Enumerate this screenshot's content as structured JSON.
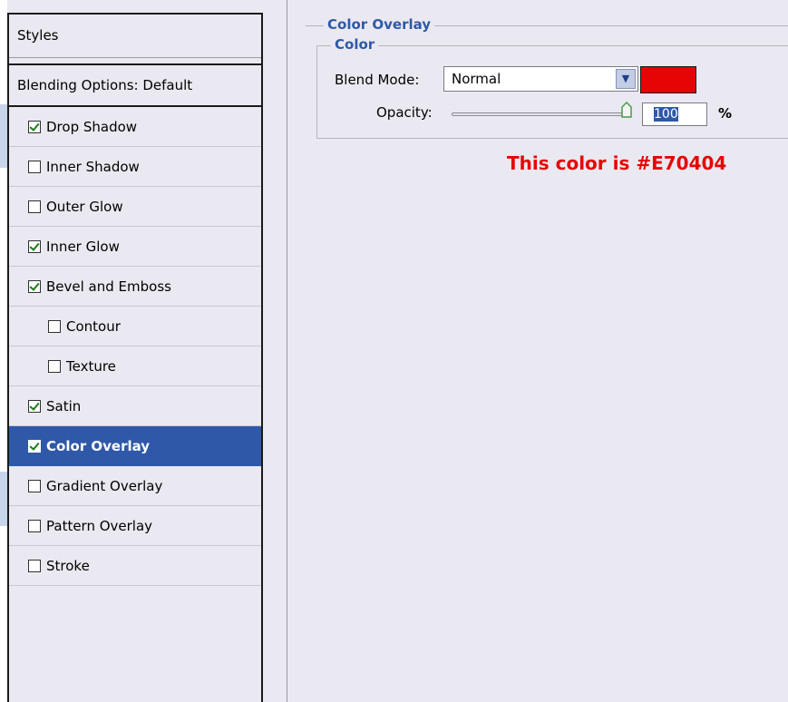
{
  "styles_panel": {
    "header": "Styles",
    "blending_options": "Blending Options: Default",
    "items": [
      {
        "label": "Drop Shadow",
        "checked": true
      },
      {
        "label": "Inner Shadow",
        "checked": false
      },
      {
        "label": "Outer Glow",
        "checked": false
      },
      {
        "label": "Inner Glow",
        "checked": true
      },
      {
        "label": "Bevel and Emboss",
        "checked": true
      },
      {
        "label": "Contour",
        "checked": false,
        "indented": true
      },
      {
        "label": "Texture",
        "checked": false,
        "indented": true
      },
      {
        "label": "Satin",
        "checked": true
      },
      {
        "label": "Color Overlay",
        "checked": true,
        "selected": true
      },
      {
        "label": "Gradient Overlay",
        "checked": false
      },
      {
        "label": "Pattern Overlay",
        "checked": false
      },
      {
        "label": "Stroke",
        "checked": false
      }
    ]
  },
  "color_overlay": {
    "section_title": "Color Overlay",
    "group_title": "Color",
    "blend_mode_label": "Blend Mode:",
    "blend_mode_value": "Normal",
    "overlay_color": "#E70404",
    "opacity_label": "Opacity:",
    "opacity_value": "100",
    "opacity_unit": "%",
    "opacity_slider_level": 1.0
  },
  "annotation": {
    "text": "This color is #E70404",
    "color": "#E70404"
  },
  "colors": {
    "selection": "#2f59a8",
    "dialog_bg": "#eae9f1"
  },
  "icons": {
    "dropdown": "chevron-down-icon",
    "slider_thumb": "slider-thumb-icon",
    "checkbox": "checkbox-icon"
  }
}
